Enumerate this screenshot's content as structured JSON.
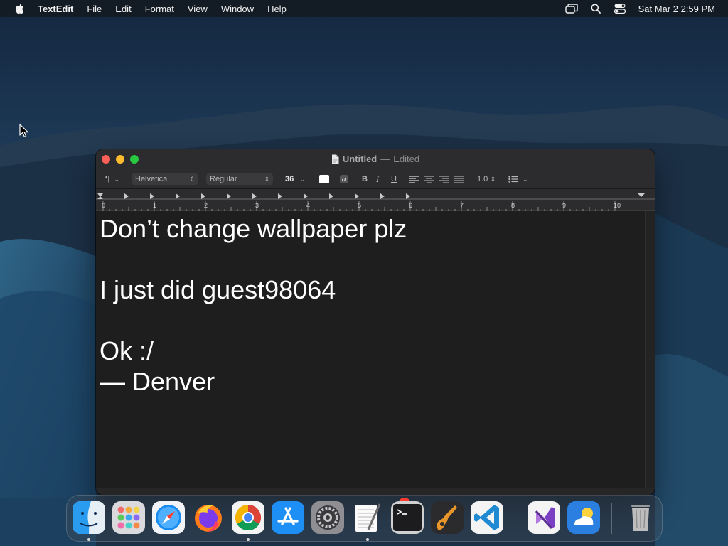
{
  "menubar": {
    "app_name": "TextEdit",
    "menus": [
      "File",
      "Edit",
      "Format",
      "View",
      "Window",
      "Help"
    ],
    "clock": "Sat Mar 2  2:59 PM"
  },
  "window": {
    "title": "Untitled",
    "separator": "—",
    "status": "Edited"
  },
  "toolbar": {
    "paragraph_symbol": "¶",
    "font_family": "Helvetica",
    "font_style": "Regular",
    "font_size": "36",
    "highlight_label": "a",
    "bold_label": "B",
    "italic_label": "I",
    "underline_label": "U",
    "line_spacing": "1.0",
    "text_color": "#ffffff"
  },
  "ruler": {
    "numbers": [
      "0",
      "1",
      "2",
      "3",
      "4",
      "5",
      "6",
      "7",
      "8",
      "9",
      "10"
    ]
  },
  "document": {
    "lines": [
      "Don’t change wallpaper plz",
      "",
      "I just did guest98064",
      "",
      "Ok :/",
      "— Denver"
    ]
  },
  "dock": {
    "apps": [
      "Finder",
      "Launchpad",
      "Safari",
      "Firefox",
      "Google Chrome",
      "App Store",
      "System Settings",
      "TextEdit",
      "Terminal",
      "GarageBand",
      "Visual Studio Code",
      "Visual Studio",
      "Weather",
      "Trash"
    ],
    "settings_badge": "1"
  },
  "colors": {
    "close": "#fe5f57",
    "minimize": "#febc2e",
    "maximize": "#28c840",
    "badge": "#ff3b30"
  }
}
